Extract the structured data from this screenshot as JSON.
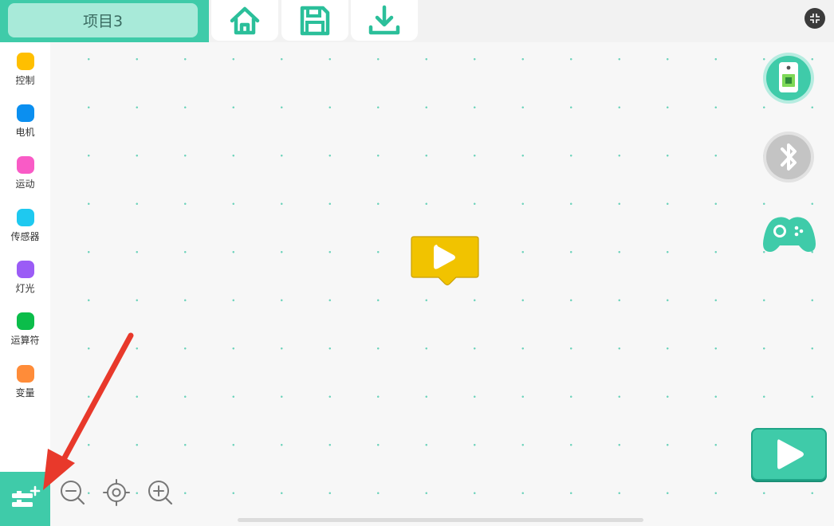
{
  "project": {
    "title": "项目3"
  },
  "toolbar": [
    {
      "name": "home-button",
      "icon": "home-icon"
    },
    {
      "name": "save-button",
      "icon": "floppy-save-icon"
    },
    {
      "name": "download-button",
      "icon": "download-icon"
    }
  ],
  "palette": {
    "categories": [
      {
        "label": "控制",
        "color": "#ffbf00"
      },
      {
        "label": "电机",
        "color": "#0b8ff0"
      },
      {
        "label": "运动",
        "color": "#f95bc6"
      },
      {
        "label": "传感器",
        "color": "#1ec9f0"
      },
      {
        "label": "灯光",
        "color": "#9b5cf6"
      },
      {
        "label": "运算符",
        "color": "#0bbd4a"
      },
      {
        "label": "变量",
        "color": "#ff8c39"
      }
    ],
    "add_extension_icon": "add-extension-icon"
  },
  "workspace": {
    "start_block_color": "#f1c300",
    "zoom_controls": [
      "zoom-out-icon",
      "recenter-icon",
      "zoom-in-icon"
    ]
  },
  "right_controls": [
    "device-board-icon",
    "bluetooth-icon",
    "gamepad-icon"
  ],
  "colors": {
    "accent": "#3fcba9",
    "accent_dark": "#1fa587"
  }
}
